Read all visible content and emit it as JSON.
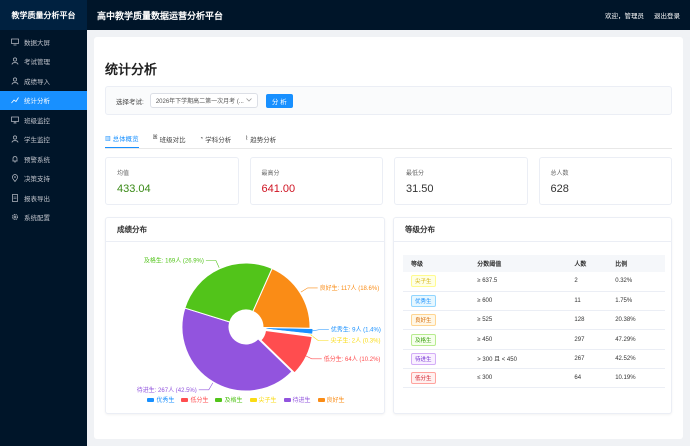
{
  "sidebar": {
    "brand": "教学质量分析平台",
    "items": [
      {
        "label": "数据大屏",
        "icon": "monitor-icon"
      },
      {
        "label": "考试管理",
        "icon": "user-icon"
      },
      {
        "label": "成绩导入",
        "icon": "person-icon"
      },
      {
        "label": "统计分析",
        "icon": "chart-icon"
      },
      {
        "label": "班级监控",
        "icon": "monitor-small-icon"
      },
      {
        "label": "学生监控",
        "icon": "student-icon"
      },
      {
        "label": "预警系统",
        "icon": "bell-icon"
      },
      {
        "label": "决策支持",
        "icon": "location-icon"
      },
      {
        "label": "报表导出",
        "icon": "document-icon"
      },
      {
        "label": "系统配置",
        "icon": "gear-icon"
      }
    ],
    "active_index": 3
  },
  "header": {
    "title": "高中教学质量数据运营分析平台",
    "welcome": "欢迎，管理员",
    "logout": "退出登录"
  },
  "page": {
    "title": "统计分析",
    "filter_label": "选择考试:",
    "exam_value": "2026年下学期高二第一次月考 (...",
    "analyze_button": "分 析"
  },
  "tabs": [
    {
      "label": "总体概览",
      "icon": "bar-chart-icon"
    },
    {
      "label": "班级对比",
      "icon": "group-icon"
    },
    {
      "label": "学科分析",
      "icon": "pie-icon"
    },
    {
      "label": "趋势分析",
      "icon": "trend-icon"
    }
  ],
  "stats": [
    {
      "label": "均值",
      "value": "433.04",
      "color": "#3a8a17"
    },
    {
      "label": "最高分",
      "value": "641.00",
      "color": "#cf1322"
    },
    {
      "label": "最低分",
      "value": "31.50",
      "color": "#333333"
    },
    {
      "label": "总人数",
      "value": "628",
      "color": "#333333"
    }
  ],
  "score_panel_title": "成绩分布",
  "grade_panel_title": "等级分布",
  "chart_data": {
    "type": "pie",
    "title": "",
    "donut": true,
    "slices": [
      {
        "name": "优秀生",
        "count": 9,
        "label": "优秀生: 9人 (1.4%)",
        "color": "#1890ff"
      },
      {
        "name": "尖子生",
        "count": 2,
        "label": "尖子生: 2人 (0.3%)",
        "color": "#fadb14"
      },
      {
        "name": "低分生",
        "count": 64,
        "label": "低分生: 64人 (10.2%)",
        "color": "#ff4d4f"
      },
      {
        "name": "待进生",
        "count": 267,
        "label": "待进生: 267人 (42.5%)",
        "color": "#9254de"
      },
      {
        "name": "及格生",
        "count": 169,
        "label": "及格生: 169人 (26.9%)",
        "color": "#52c41a"
      },
      {
        "name": "良好生",
        "count": 117,
        "label": "良好生: 117人 (18.6%)",
        "color": "#fa8c16"
      }
    ],
    "legend": [
      "优秀生",
      "低分生",
      "及格生",
      "尖子生",
      "待进生",
      "良好生"
    ],
    "legend_placement": "bottom"
  },
  "grade_table": {
    "headers": [
      "等级",
      "分数阈值",
      "人数",
      "比例"
    ],
    "rows": [
      {
        "grade": "尖子生",
        "threshold": "≥ 637.5",
        "count": "2",
        "ratio": "0.32%",
        "color": "#d4b106",
        "bg": "#feffe6",
        "border": "#fffb8f"
      },
      {
        "grade": "优秀生",
        "threshold": "≥ 600",
        "count": "11",
        "ratio": "1.75%",
        "color": "#1890ff",
        "bg": "#e6f7ff",
        "border": "#91d5ff"
      },
      {
        "grade": "良好生",
        "threshold": "≥ 525",
        "count": "128",
        "ratio": "20.38%",
        "color": "#d46b08",
        "bg": "#fff7e6",
        "border": "#ffd591"
      },
      {
        "grade": "及格生",
        "threshold": "≥ 450",
        "count": "297",
        "ratio": "47.29%",
        "color": "#389e0d",
        "bg": "#f6ffed",
        "border": "#b7eb8f"
      },
      {
        "grade": "待进生",
        "threshold": "> 300 且 < 450",
        "count": "267",
        "ratio": "42.52%",
        "color": "#722ed1",
        "bg": "#f9f0ff",
        "border": "#d3adf7"
      },
      {
        "grade": "低分生",
        "threshold": "≤ 300",
        "count": "64",
        "ratio": "10.19%",
        "color": "#cf1322",
        "bg": "#fff1f0",
        "border": "#ffa39e"
      }
    ]
  }
}
